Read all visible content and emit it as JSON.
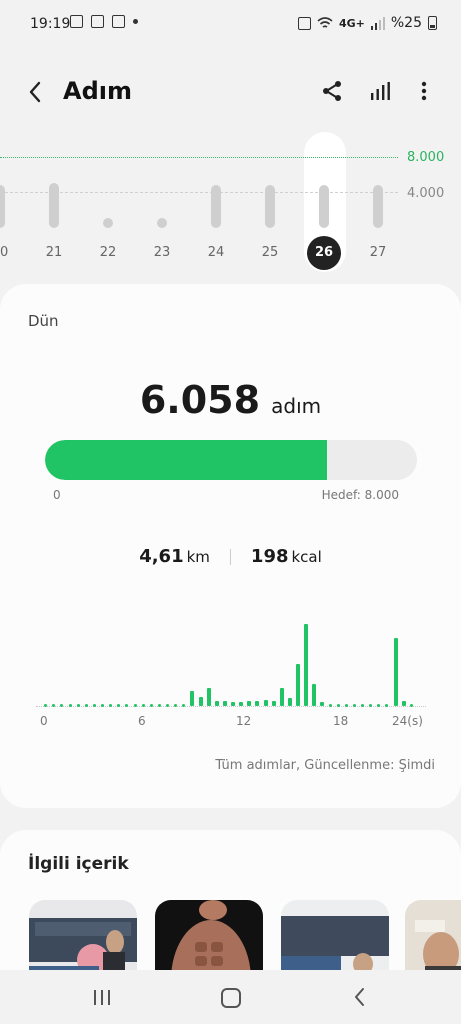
{
  "status": {
    "time": "19:19",
    "battery": "%25",
    "network": "4G+"
  },
  "header": {
    "title": "Adım"
  },
  "week_chart": {
    "goal_label": "8.000",
    "ref_label": "4.000",
    "selected": "26",
    "days": [
      {
        "label": "20",
        "steps": 5000
      },
      {
        "label": "21",
        "steps": 5300
      },
      {
        "label": "22",
        "steps": 0
      },
      {
        "label": "23",
        "steps": 0
      },
      {
        "label": "24",
        "steps": 5000
      },
      {
        "label": "25",
        "steps": 5000
      },
      {
        "label": "26",
        "steps": 5000
      },
      {
        "label": "27",
        "steps": 5000
      }
    ]
  },
  "summary": {
    "day": "Dün",
    "steps": "6.058",
    "steps_unit": "adım",
    "progress": 0.757,
    "progress_min": "0",
    "progress_goal": "Hedef: 8.000",
    "distance": "4,61",
    "distance_unit": "km",
    "calories": "198",
    "calories_unit": "kcal",
    "footnote": "Tüm adımlar, Güncellenme: Şimdi"
  },
  "hour_chart": {
    "ticks": [
      "0",
      "6",
      "12",
      "18",
      "24(s)"
    ],
    "values": [
      0,
      0,
      0,
      0,
      0,
      0,
      0,
      0,
      0,
      0,
      0,
      0,
      0,
      0,
      0,
      0,
      0,
      0,
      0,
      0,
      0,
      0,
      0,
      0,
      0,
      0,
      0,
      0,
      0,
      0,
      0,
      0,
      0,
      0,
      0,
      0,
      0,
      0,
      0,
      0,
      0,
      0,
      0,
      0,
      0,
      0,
      0,
      0,
      0,
      0,
      0,
      0,
      0,
      0,
      0,
      0,
      0,
      0,
      0,
      0,
      0,
      0,
      0,
      0,
      0,
      0,
      0,
      0,
      0,
      0,
      0,
      0,
      0,
      0,
      0,
      0,
      0,
      0,
      0,
      0,
      0,
      0,
      0,
      0,
      0,
      0,
      0,
      0,
      0,
      0,
      0,
      0,
      0,
      0,
      0,
      0
    ]
  },
  "related": {
    "title": "İlgili içerik"
  }
}
